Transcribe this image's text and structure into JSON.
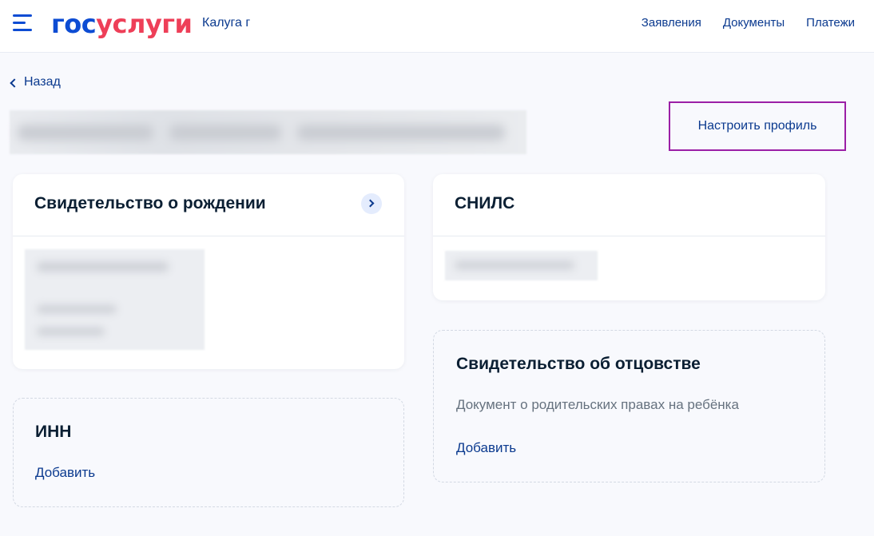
{
  "header": {
    "logo_part1": "гос",
    "logo_part2": "услуги",
    "city": "Калуга г",
    "nav": [
      {
        "label": "Заявления"
      },
      {
        "label": "Документы"
      },
      {
        "label": "Платежи"
      }
    ]
  },
  "back_label": "Назад",
  "setup_profile_label": "Настроить профиль",
  "cards": {
    "birth_certificate": {
      "title": "Свидетельство о рождении"
    },
    "snils": {
      "title": "СНИЛС"
    },
    "inn": {
      "title": "ИНН",
      "add_label": "Добавить"
    },
    "paternity": {
      "title": "Свидетельство об отцовстве",
      "description": "Документ о родительских правах на ребёнка",
      "add_label": "Добавить"
    }
  },
  "colors": {
    "brand_blue": "#0d4cd3",
    "brand_red": "#ee3f58",
    "link": "#0b3a8f",
    "highlight_border": "#9b1fa6"
  }
}
